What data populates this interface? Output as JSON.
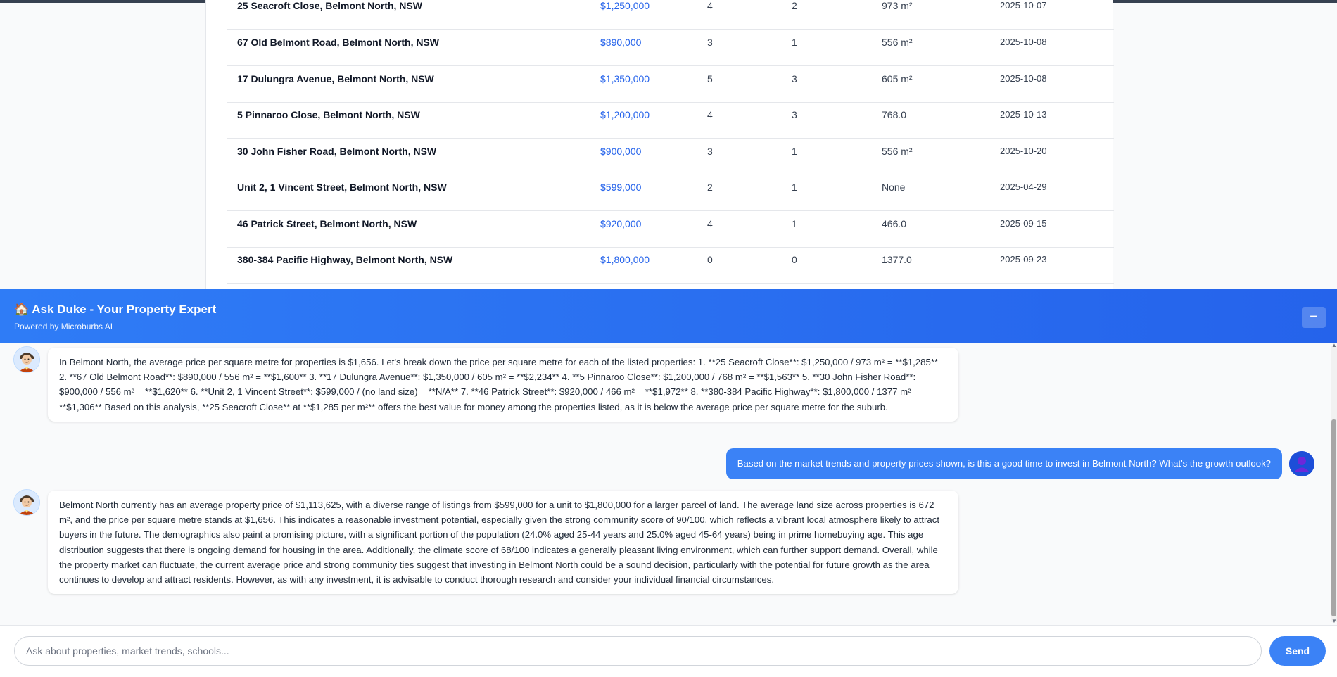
{
  "listings": [
    {
      "address": "25 Seacroft Close, Belmont North, NSW",
      "price": "$1,250,000",
      "beds": "4",
      "baths": "2",
      "land": "973 m²",
      "date": "2025-10-07"
    },
    {
      "address": "67 Old Belmont Road, Belmont North, NSW",
      "price": "$890,000",
      "beds": "3",
      "baths": "1",
      "land": "556 m²",
      "date": "2025-10-08"
    },
    {
      "address": "17 Dulungra Avenue, Belmont North, NSW",
      "price": "$1,350,000",
      "beds": "5",
      "baths": "3",
      "land": "605 m²",
      "date": "2025-10-08"
    },
    {
      "address": "5 Pinnaroo Close, Belmont North, NSW",
      "price": "$1,200,000",
      "beds": "4",
      "baths": "3",
      "land": "768.0",
      "date": "2025-10-13"
    },
    {
      "address": "30 John Fisher Road, Belmont North, NSW",
      "price": "$900,000",
      "beds": "3",
      "baths": "1",
      "land": "556 m²",
      "date": "2025-10-20"
    },
    {
      "address": "Unit 2, 1 Vincent Street, Belmont North, NSW",
      "price": "$599,000",
      "beds": "2",
      "baths": "1",
      "land": "None",
      "date": "2025-04-29"
    },
    {
      "address": "46 Patrick Street, Belmont North, NSW",
      "price": "$920,000",
      "beds": "4",
      "baths": "1",
      "land": "466.0",
      "date": "2025-09-15"
    },
    {
      "address": "380-384 Pacific Highway, Belmont North, NSW",
      "price": "$1,800,000",
      "beds": "0",
      "baths": "0",
      "land": "1377.0",
      "date": "2025-09-23"
    }
  ],
  "chat": {
    "title": "🏠 Ask Duke - Your Property Expert",
    "subtitle": "Powered by Microburbs AI",
    "minimize_label": "−",
    "messages": [
      {
        "role": "bot",
        "text": "In Belmont North, the average price per square metre for properties is $1,656. Let's break down the price per square metre for each of the listed properties: 1. **25 Seacroft Close**: $1,250,000 / 973 m² = **$1,285** 2. **67 Old Belmont Road**: $890,000 / 556 m² = **$1,600** 3. **17 Dulungra Avenue**: $1,350,000 / 605 m² = **$2,234** 4. **5 Pinnaroo Close**: $1,200,000 / 768 m² = **$1,563** 5. **30 John Fisher Road**: $900,000 / 556 m² = **$1,620** 6. **Unit 2, 1 Vincent Street**: $599,000 / (no land size) = **N/A** 7. **46 Patrick Street**: $920,000 / 466 m² = **$1,972** 8. **380-384 Pacific Highway**: $1,800,000 / 1377 m² = **$1,306** Based on this analysis, **25 Seacroft Close** at **$1,285 per m²** offers the best value for money among the properties listed, as it is below the average price per square metre for the suburb."
      },
      {
        "role": "user",
        "text": "Based on the market trends and property prices shown, is this a good time to invest in Belmont North? What's the growth outlook?"
      },
      {
        "role": "bot",
        "text": "Belmont North currently has an average property price of $1,113,625, with a diverse range of listings from $599,000 for a unit to $1,800,000 for a larger parcel of land. The average land size across properties is 672 m², and the price per square metre stands at $1,656. This indicates a reasonable investment potential, especially given the strong community score of 90/100, which reflects a vibrant local atmosphere likely to attract buyers in the future. The demographics also paint a promising picture, with a significant portion of the population (24.0% aged 25-44 years and 25.0% aged 45-64 years) being in prime homebuying age. This age distribution suggests that there is ongoing demand for housing in the area. Additionally, the climate score of 68/100 indicates a generally pleasant living environment, which can further support demand. Overall, while the property market can fluctuate, the current average price and strong community ties suggest that investing in Belmont North could be a sound decision, particularly with the potential for future growth as the area continues to develop and attract residents. However, as with any investment, it is advisable to conduct thorough research and consider your individual financial circumstances."
      }
    ],
    "input_placeholder": "Ask about properties, market trends, schools...",
    "input_value": "",
    "send_label": "Send"
  },
  "colors": {
    "accent": "#3b82f6",
    "header": "#2563eb",
    "price_link": "#2563eb"
  }
}
